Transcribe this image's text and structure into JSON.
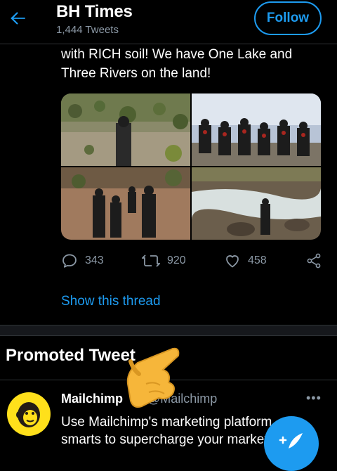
{
  "header": {
    "title": "BH Times",
    "tweet_count": "1,444 Tweets",
    "follow_label": "Follow"
  },
  "tweet": {
    "text": "with RICH soil! We have One Lake and Three Rivers on the land!",
    "replies": "343",
    "retweets": "920",
    "likes": "458",
    "show_thread": "Show this thread"
  },
  "promoted": {
    "section_title": "Promoted Tweet",
    "name": "Mailchimp",
    "handle": "@Mailchimp",
    "text_line1": "Use Mailchimp's marketing platform",
    "text_line2": "smarts to supercharge your marketing"
  },
  "colors": {
    "accent": "#1d9bf0",
    "background": "#000000",
    "muted": "#8b98a5",
    "divider": "#2f3336",
    "mailchimp_yellow": "#ffe01b"
  },
  "icons": {
    "back": "arrow-left-icon",
    "reply": "reply-icon",
    "retweet": "retweet-icon",
    "like": "heart-icon",
    "share": "share-icon",
    "more": "more-icon",
    "compose": "compose-icon",
    "avatar": "mailchimp-freddie-logo",
    "overlay": "pointing-hand-emoji"
  }
}
